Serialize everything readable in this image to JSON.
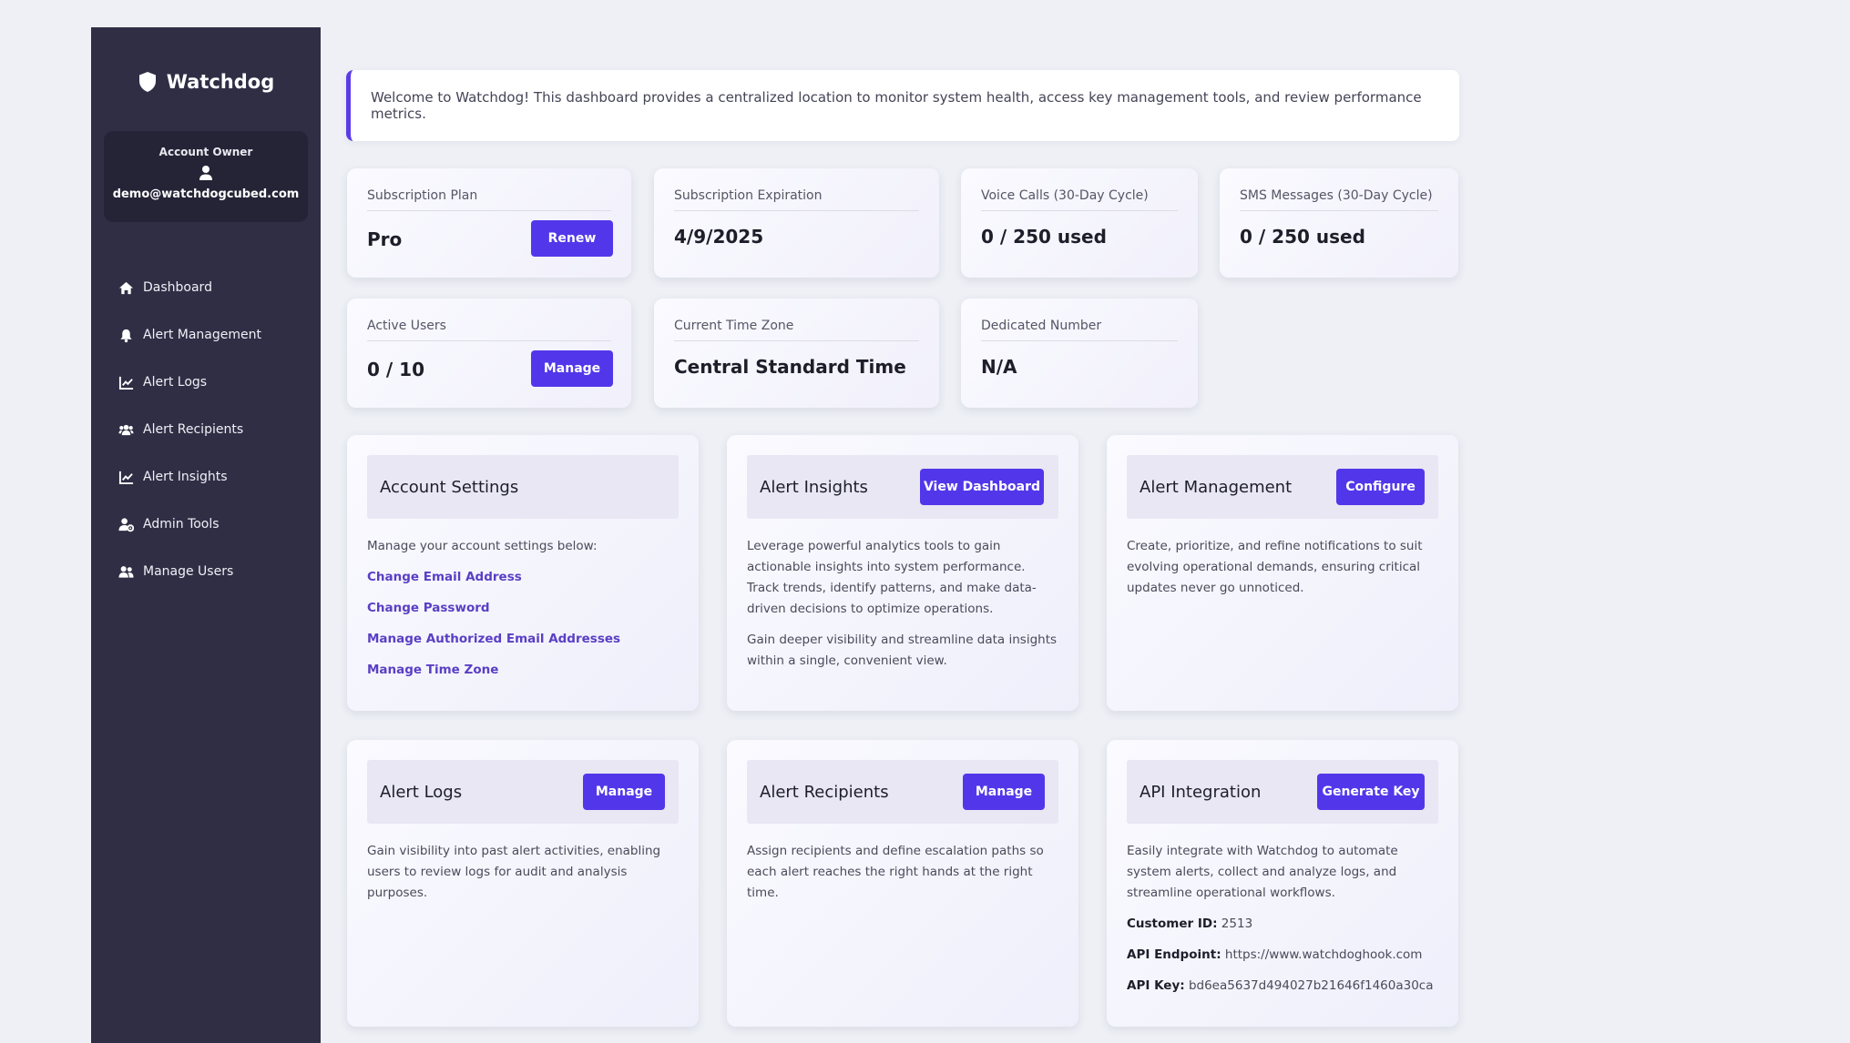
{
  "sidebar": {
    "brand": "Watchdog",
    "owner_label": "Account Owner",
    "owner_email": "demo@watchdogcubed.com",
    "items": [
      {
        "label": "Dashboard",
        "icon": "home-icon"
      },
      {
        "label": "Alert Management",
        "icon": "bell-icon"
      },
      {
        "label": "Alert Logs",
        "icon": "line-chart-icon"
      },
      {
        "label": "Alert Recipients",
        "icon": "users-group-icon"
      },
      {
        "label": "Alert Insights",
        "icon": "line-chart-icon"
      },
      {
        "label": "Admin Tools",
        "icon": "user-gear-icon"
      },
      {
        "label": "Manage Users",
        "icon": "users-icon"
      }
    ]
  },
  "welcome": "Welcome to Watchdog! This dashboard provides a centralized location to monitor system health, access key management tools, and review performance metrics.",
  "stats": {
    "plan": {
      "label": "Subscription Plan",
      "value": "Pro",
      "button": "Renew"
    },
    "expiration": {
      "label": "Subscription Expiration",
      "value": "4/9/2025"
    },
    "voice": {
      "label": "Voice Calls (30-Day Cycle)",
      "value": "0 / 250 used"
    },
    "sms": {
      "label": "SMS Messages (30-Day Cycle)",
      "value": "0 / 250 used"
    },
    "users": {
      "label": "Active Users",
      "value": "0 / 10",
      "button": "Manage"
    },
    "timezone": {
      "label": "Current Time Zone",
      "value": "Central Standard Time"
    },
    "number": {
      "label": "Dedicated Number",
      "value": "N/A"
    }
  },
  "cards": {
    "account": {
      "title": "Account Settings",
      "intro": "Manage your account settings below:",
      "links": [
        "Change Email Address",
        "Change Password",
        "Manage Authorized Email Addresses",
        "Manage Time Zone"
      ]
    },
    "insights": {
      "title": "Alert Insights",
      "button": "View Dashboard",
      "p1": "Leverage powerful analytics tools to gain actionable insights into system performance. Track trends, identify patterns, and make data-driven decisions to optimize operations.",
      "p2": "Gain deeper visibility and streamline data insights within a single, convenient view."
    },
    "management": {
      "title": "Alert Management",
      "button": "Configure",
      "p1": "Create, prioritize, and refine notifications to suit evolving operational demands, ensuring critical updates never go unnoticed."
    },
    "logs": {
      "title": "Alert Logs",
      "button": "Manage",
      "p1": "Gain visibility into past alert activities, enabling users to review logs for audit and analysis purposes."
    },
    "recipients": {
      "title": "Alert Recipients",
      "button": "Manage",
      "p1": "Assign recipients and define escalation paths so each alert reaches the right hands at the right time."
    },
    "api": {
      "title": "API Integration",
      "button": "Generate Key",
      "p1": "Easily integrate with Watchdog to automate system alerts, collect and analyze logs, and streamline operational workflows.",
      "customer_id_label": "Customer ID:",
      "customer_id": "2513",
      "endpoint_label": "API Endpoint:",
      "endpoint": "https://www.watchdoghook.com",
      "key_label": "API Key:",
      "key": "bd6ea5637d494027b21646f1460a30ca"
    }
  }
}
